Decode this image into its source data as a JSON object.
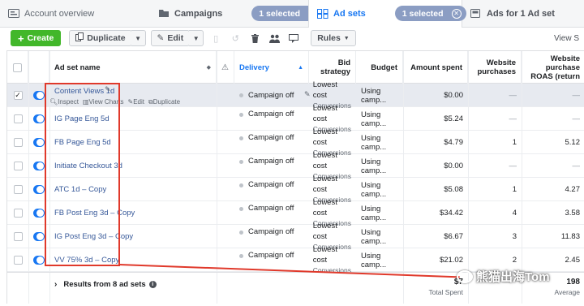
{
  "tabs": [
    {
      "label": "Account overview",
      "icon": "account-overview-icon"
    },
    {
      "label": "Campaigns",
      "icon": "campaigns-icon",
      "badge": "1 selected"
    },
    {
      "label": "Ad sets",
      "icon": "ad-sets-icon",
      "badge": "1 selected",
      "active": true
    },
    {
      "label": "Ads for 1 Ad set",
      "icon": "ads-icon"
    }
  ],
  "toolbar": {
    "create": "Create",
    "duplicate": "Duplicate",
    "edit": "Edit",
    "rules": "Rules",
    "view": "View S"
  },
  "columns": {
    "name": "Ad set name",
    "delivery": "Delivery",
    "bid": "Bid strategy",
    "budget": "Budget",
    "spent": "Amount spent",
    "purchases": "Website purchases",
    "roas": "Website purchase ROAS (return"
  },
  "row_actions": {
    "inspect": "Inspect",
    "charts": "View Charts",
    "edit": "Edit",
    "duplicate": "Duplicate"
  },
  "rows": [
    {
      "name": "Content Views 1d",
      "delivery": "Campaign off",
      "bid": "Lowest cost",
      "bid_sub": "Conversions",
      "budget": "Using camp...",
      "spent": "$0.00",
      "purchases": "—",
      "roas": "—",
      "checked": true
    },
    {
      "name": "IG Page Eng 5d",
      "delivery": "Campaign off",
      "bid": "Lowest cost",
      "bid_sub": "Conversions",
      "budget": "Using camp...",
      "spent": "$5.24",
      "purchases": "—",
      "roas": "—"
    },
    {
      "name": "FB Page Eng 5d",
      "delivery": "Campaign off",
      "bid": "Lowest cost",
      "bid_sub": "Conversions",
      "budget": "Using camp...",
      "spent": "$4.79",
      "purchases": "1",
      "roas": "5.12"
    },
    {
      "name": "Initiate Checkout 3d",
      "delivery": "Campaign off",
      "bid": "Lowest cost",
      "bid_sub": "Conversions",
      "budget": "Using camp...",
      "spent": "$0.00",
      "purchases": "—",
      "roas": "—"
    },
    {
      "name": "ATC 1d – Copy",
      "delivery": "Campaign off",
      "bid": "Lowest cost",
      "bid_sub": "Conversions",
      "budget": "Using camp...",
      "spent": "$5.08",
      "purchases": "1",
      "roas": "4.27"
    },
    {
      "name": "FB Post Eng 3d – Copy",
      "delivery": "Campaign off",
      "bid": "Lowest cost",
      "bid_sub": "Conversions",
      "budget": "Using camp...",
      "spent": "$34.42",
      "purchases": "4",
      "roas": "3.58"
    },
    {
      "name": "IG Post Eng 3d – Copy",
      "delivery": "Campaign off",
      "bid": "Lowest cost",
      "bid_sub": "Conversions",
      "budget": "Using camp...",
      "spent": "$6.67",
      "purchases": "3",
      "roas": "11.83"
    },
    {
      "name": "VV 75% 3d – Copy",
      "delivery": "Campaign off",
      "bid": "Lowest cost",
      "bid_sub": "Conversions",
      "budget": "Using camp...",
      "spent": "$21.02",
      "purchases": "2",
      "roas": "2.45"
    }
  ],
  "footer": {
    "results": "Results from 8 ad sets",
    "spent_value": "$7",
    "spent_label": "Total Spent",
    "roas_value": "198",
    "roas_label": "Average"
  },
  "watermark": "熊猫出海Tom",
  "colors": {
    "accent": "#1877f2",
    "create": "#42b72a",
    "highlight": "#e0392b",
    "pill": "#8b9dc3"
  }
}
